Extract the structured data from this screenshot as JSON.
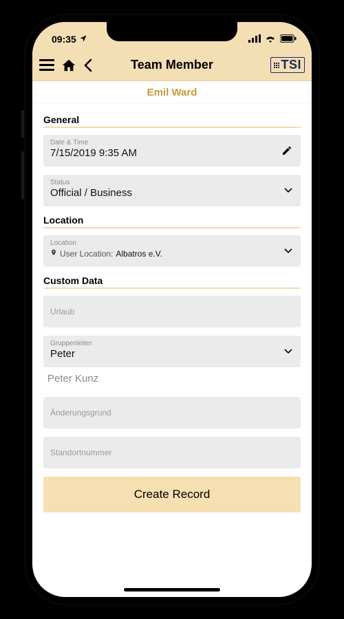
{
  "status": {
    "time": "09:35"
  },
  "header": {
    "title": "Team Member",
    "logo": "TSI"
  },
  "member": {
    "name": "Emil Ward"
  },
  "sections": {
    "general": {
      "title": "General",
      "datetime": {
        "label": "Date & Time",
        "value": "7/15/2019 9:35 AM"
      },
      "status": {
        "label": "Status",
        "value": "Official / Business"
      }
    },
    "location": {
      "title": "Location",
      "field": {
        "label": "Location",
        "prefix": "User Location:",
        "value": "Albatros e.V."
      }
    },
    "custom": {
      "title": "Custom Data",
      "urlaub": {
        "label": "Urlaub"
      },
      "gruppenleiter": {
        "label": "Gruppenleiter",
        "value": "Peter"
      },
      "freeText": "Peter Kunz",
      "aenderungsgrund": {
        "label": "Änderungsgrund"
      },
      "standortnummer": {
        "label": "Standortnummer"
      }
    }
  },
  "actions": {
    "create": "Create Record"
  }
}
